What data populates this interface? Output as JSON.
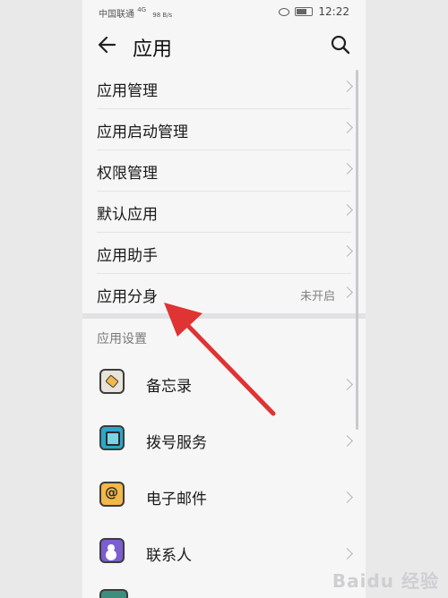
{
  "status_bar": {
    "carrier": "中国联通",
    "signal_text": "4G",
    "speed": "98 B/s",
    "battery": "69",
    "time": "12:22"
  },
  "header": {
    "title": "应用",
    "back_icon": "back-arrow-icon",
    "search_icon": "search-icon"
  },
  "menu": {
    "items": [
      {
        "label": "应用管理",
        "value": ""
      },
      {
        "label": "应用启动管理",
        "value": ""
      },
      {
        "label": "权限管理",
        "value": ""
      },
      {
        "label": "默认应用",
        "value": ""
      },
      {
        "label": "应用助手",
        "value": ""
      },
      {
        "label": "应用分身",
        "value": "未开启"
      }
    ]
  },
  "app_settings": {
    "section_title": "应用设置",
    "apps": [
      {
        "name": "备忘录",
        "icon": "notes-icon"
      },
      {
        "name": "拨号服务",
        "icon": "phone-icon"
      },
      {
        "name": "电子邮件",
        "icon": "mail-icon"
      },
      {
        "name": "联系人",
        "icon": "contacts-icon"
      }
    ]
  },
  "annotation": {
    "color": "#e03333"
  },
  "watermark": "Baidu 经验"
}
